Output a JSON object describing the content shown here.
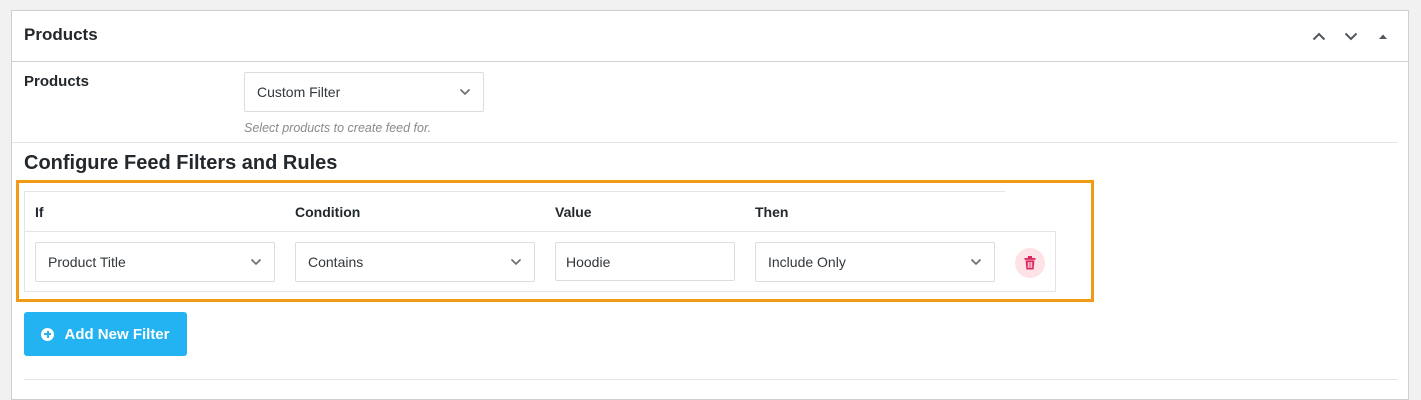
{
  "panel": {
    "title": "Products",
    "actions": [
      {
        "name": "move-up-icon",
        "glyph": "chevron-up"
      },
      {
        "name": "move-down-icon",
        "glyph": "chevron-down"
      },
      {
        "name": "toggle-panel-icon",
        "glyph": "triangle-up"
      }
    ]
  },
  "products": {
    "label": "Products",
    "selected": "Custom Filter",
    "hint": "Select products to create feed for."
  },
  "filters": {
    "title": "Configure Feed Filters and Rules",
    "headers": {
      "if": "If",
      "condition": "Condition",
      "value": "Value",
      "then": "Then"
    },
    "rows": [
      {
        "if": "Product Title",
        "condition": "Contains",
        "value": "Hoodie",
        "then": "Include Only"
      }
    ],
    "add_button": "Add New Filter"
  },
  "colors": {
    "highlight": "#f09a16",
    "primary_button": "#23b2f2",
    "delete_icon": "#e0245e",
    "delete_bg": "#fde2e6"
  }
}
